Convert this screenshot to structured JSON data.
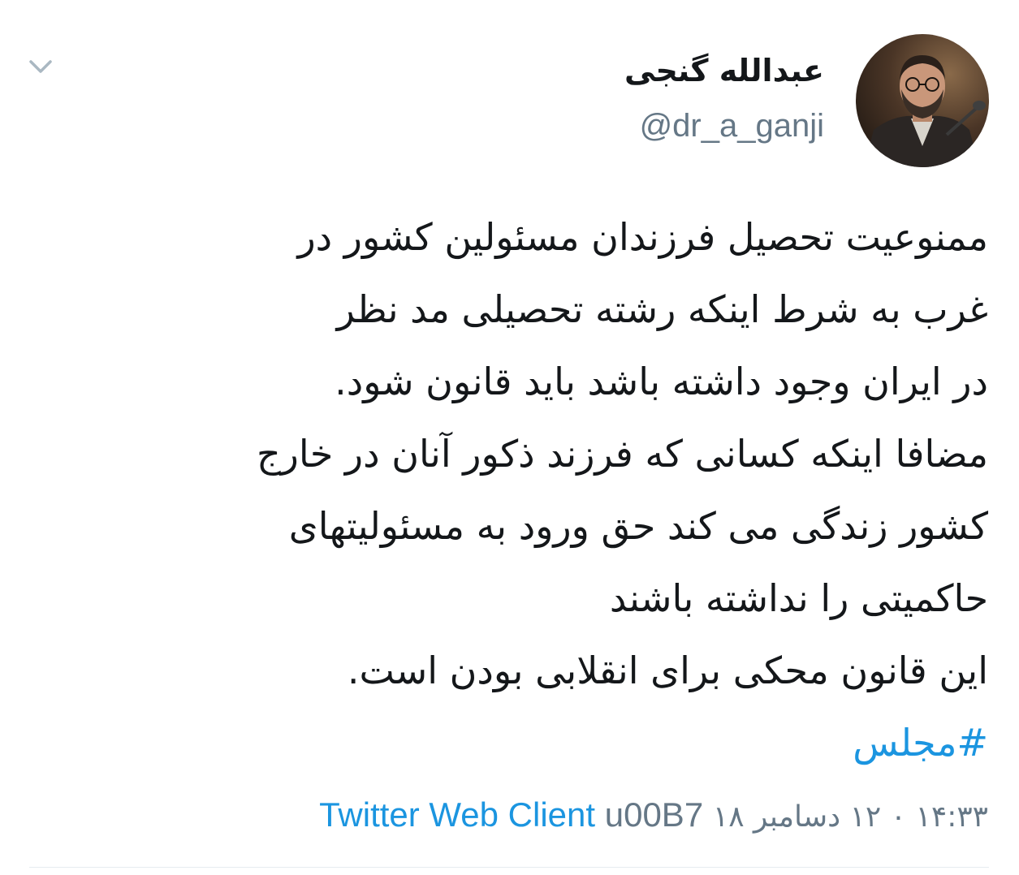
{
  "tweet": {
    "author": {
      "display_name": "عبدالله گنجی",
      "handle": "@dr_a_ganji"
    },
    "text_lines": [
      "ممنوعیت تحصیل فرزندان مسئولین کشور در",
      "غرب به شرط اینکه رشته تحصیلی  مد نظر",
      "در ایران وجود داشته باشد باید قانون شود.",
      "مضافا اینکه کسانی که فرزند ذکور آنان در خارج",
      "کشور زندگی می کند حق ورود به مسئولیتهای",
      "حاکمیتی را نداشته باشند",
      "این قانون محکی برای انقلابی بودن است."
    ],
    "hashtag": "#مجلس",
    "timestamp": "۱۴:۳۳ ۰ ۱۲ دسامبر ۱۸",
    "separator": "u00B7",
    "source": "Twitter Web Client",
    "menu_icon": "chevron-down-icon"
  },
  "colors": {
    "link": "#1b95e0",
    "secondary_text": "#657786",
    "primary_text": "#14171a",
    "divider": "#e6ecf0"
  }
}
